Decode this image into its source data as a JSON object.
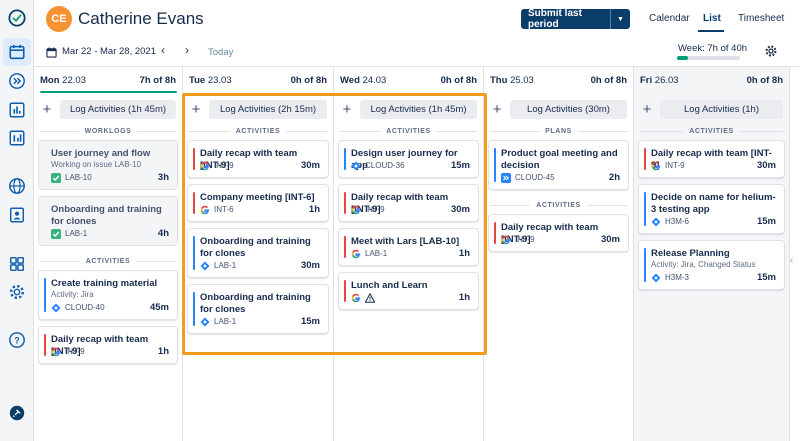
{
  "user": {
    "initials": "CE",
    "name": "Catherine Evans"
  },
  "header": {
    "submit_label": "Submit last period",
    "tabs": [
      {
        "label": "Calendar",
        "active": false
      },
      {
        "label": "List",
        "active": true
      },
      {
        "label": "Timesheet",
        "active": false
      }
    ]
  },
  "toolbar": {
    "date_range": "Mar 22 - Mar 28, 2021",
    "today_label": "Today",
    "week_label": "Week: 7h of 40h",
    "week_progress": 0.175
  },
  "colors": {
    "accent_brand": "#0B3D6B",
    "progress": "#00A07A",
    "highlight": "#F39C1F",
    "bar_red": "#E2483D",
    "bar_blue": "#2684FF",
    "jira_blue": "#2684FF",
    "google_multicolor": [
      "#4285F4",
      "#EA4335",
      "#FBBC05",
      "#34A853"
    ]
  },
  "days": [
    {
      "day": "Mon",
      "date": "22.03",
      "total": "7h of 8h",
      "progress": 1,
      "log_label": "Log Activities (1h 45m)",
      "sections": [
        {
          "label": "WORKLOGS",
          "cards": [
            {
              "kind": "worklog",
              "title": "User journey and flow",
              "subtitle": "Working on issue LAB-10",
              "source": "check",
              "issue": "LAB-10",
              "duration": "3h"
            },
            {
              "kind": "worklog",
              "title": "Onboarding and training for clones",
              "subtitle": "",
              "source": "check",
              "issue": "LAB-1",
              "duration": "4h"
            }
          ]
        },
        {
          "label": "ACTIVITIES",
          "cards": [
            {
              "kind": "activity",
              "bar": "blue",
              "title": "Create training material",
              "subtitle": "Activity: Jira",
              "source": "jira",
              "issue": "CLOUD-40",
              "duration": "45m"
            },
            {
              "kind": "activity",
              "bar": "red",
              "title": "Daily recap with team [INT-9]",
              "subtitle": "",
              "source": "google",
              "issue": "INT-9",
              "duration": "1h"
            }
          ]
        }
      ]
    },
    {
      "day": "Tue",
      "date": "23.03",
      "total": "0h of 8h",
      "progress": 0,
      "log_label": "Log Activities (2h 15m)",
      "sections": [
        {
          "label": "ACTIVITIES",
          "cards": [
            {
              "kind": "activity",
              "bar": "red",
              "title": "Daily recap with team [INT-9]",
              "subtitle": "",
              "source": "google",
              "issue": "INT-9",
              "duration": "30m"
            },
            {
              "kind": "activity",
              "bar": "red",
              "title": "Company meeting [INT-6]",
              "subtitle": "",
              "source": "google",
              "issue": "INT-6",
              "duration": "1h"
            },
            {
              "kind": "activity",
              "bar": "blue",
              "title": "Onboarding and training for clones",
              "subtitle": "",
              "source": "jira",
              "issue": "LAB-1",
              "duration": "30m"
            },
            {
              "kind": "activity",
              "bar": "blue",
              "title": "Onboarding and training for clones",
              "subtitle": "",
              "source": "jira",
              "issue": "LAB-1",
              "duration": "15m"
            }
          ]
        }
      ]
    },
    {
      "day": "Wed",
      "date": "24.03",
      "total": "0h of 8h",
      "progress": 0,
      "log_label": "Log Activities (1h 45m)",
      "sections": [
        {
          "label": "ACTIVITIES",
          "cards": [
            {
              "kind": "activity",
              "bar": "blue",
              "title": "Design user journey for app",
              "subtitle": "",
              "source": "jira",
              "issue": "CLOUD-36",
              "duration": "15m"
            },
            {
              "kind": "activity",
              "bar": "red",
              "title": "Daily recap with team [INT-9]",
              "subtitle": "",
              "source": "google",
              "issue": "INT-9",
              "duration": "30m"
            },
            {
              "kind": "activity",
              "bar": "red",
              "title": "Meet with Lars [LAB-10]",
              "subtitle": "",
              "source": "google",
              "issue": "LAB-1",
              "duration": "1h"
            },
            {
              "kind": "activity",
              "bar": "red",
              "title": "Lunch and Learn",
              "subtitle": "",
              "source": "google-warning",
              "issue": "",
              "duration": "1h"
            }
          ]
        }
      ]
    },
    {
      "day": "Thu",
      "date": "25.03",
      "total": "0h of 8h",
      "progress": 0,
      "log_label": "Log Activities (30m)",
      "sections": [
        {
          "label": "PLANS",
          "cards": [
            {
              "kind": "activity",
              "bar": "blue",
              "title": "Product goal meeting and decision",
              "subtitle": "",
              "source": "plan",
              "issue": "CLOUD-45",
              "duration": "2h"
            }
          ]
        },
        {
          "label": "ACTIVITIES",
          "cards": [
            {
              "kind": "activity",
              "bar": "red",
              "title": "Daily recap with team [INT-9]",
              "subtitle": "",
              "source": "google",
              "issue": "INT-9",
              "duration": "30m"
            }
          ]
        }
      ]
    },
    {
      "day": "Fri",
      "date": "26.03",
      "total": "0h of 8h",
      "progress": 0,
      "log_label": "Log Activities (1h)",
      "sections": [
        {
          "label": "ACTIVITIES",
          "cards": [
            {
              "kind": "activity",
              "bar": "red",
              "title": "Daily recap with team [INT-9]",
              "subtitle": "",
              "source": "google",
              "issue": "INT-9",
              "duration": "30m"
            },
            {
              "kind": "activity",
              "bar": "blue",
              "title": "Decide on name for helium-3 testing app",
              "subtitle": "",
              "source": "jira",
              "issue": "H3M-6",
              "duration": "15m"
            },
            {
              "kind": "activity",
              "bar": "blue",
              "title": "Release Planning",
              "subtitle": "Activity: Jira, Changed Status",
              "source": "jira",
              "issue": "H3M-3",
              "duration": "15m"
            }
          ]
        }
      ]
    }
  ],
  "rail_icons": [
    "logo-icon",
    "calendar-icon",
    "chevrons-right-icon",
    "bar-chart-icon",
    "report-icon",
    "globe-icon",
    "person-card-icon",
    "grid-icon",
    "gear-icon",
    "help-icon",
    "pin-icon"
  ]
}
